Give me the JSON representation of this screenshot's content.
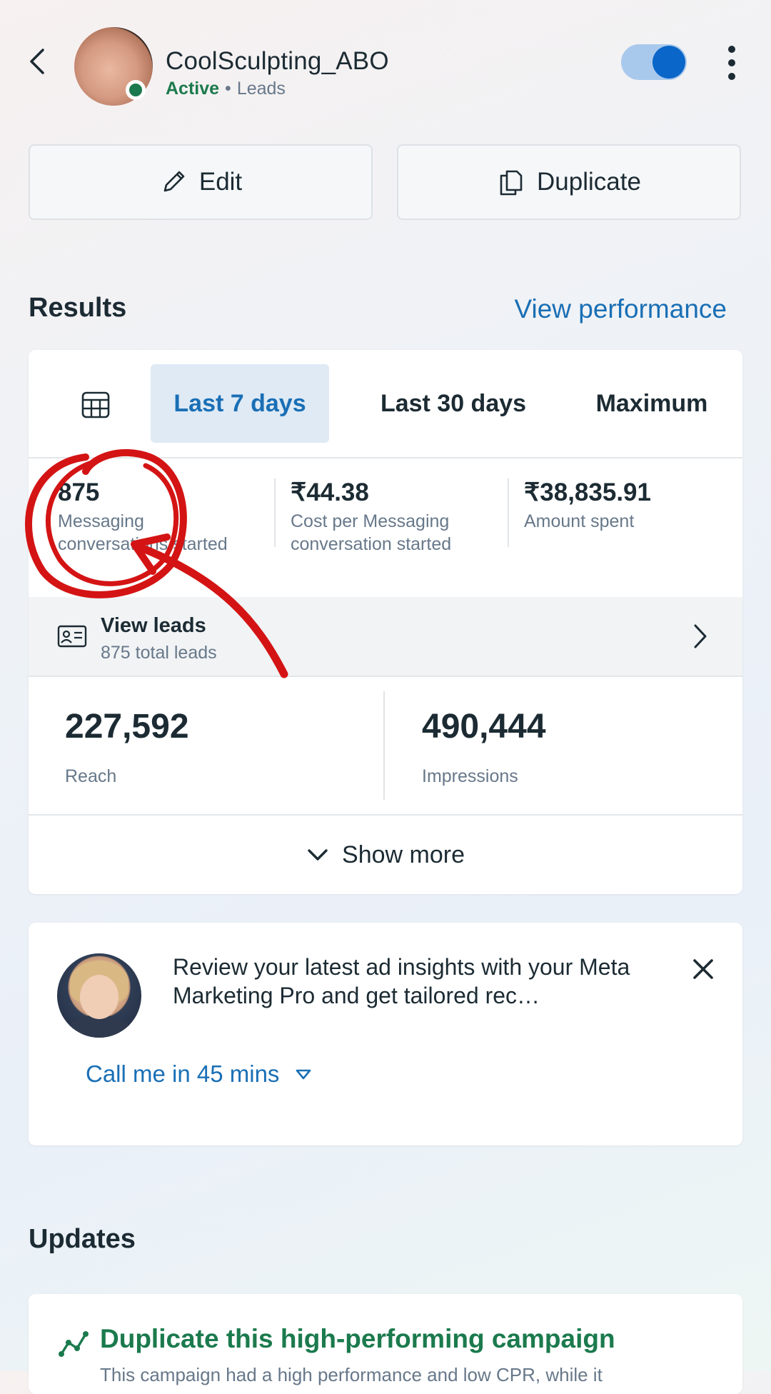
{
  "header": {
    "campaign_name": "CoolSculpting_ABO",
    "status": "Active",
    "separator": "•",
    "objective": "Leads",
    "toggle_on": true
  },
  "actions": {
    "edit_label": "Edit",
    "duplicate_label": "Duplicate"
  },
  "results": {
    "heading": "Results",
    "view_performance": "View performance",
    "tabs": [
      {
        "label": "Last 7 days",
        "selected": true
      },
      {
        "label": "Last 30 days",
        "selected": false
      },
      {
        "label": "Maximum",
        "selected": false
      }
    ],
    "metrics": [
      {
        "value": "875",
        "label": "Messaging conversations started"
      },
      {
        "value": "₹44.38",
        "label": "Cost per Messaging conversation started"
      },
      {
        "value": "₹38,835.91",
        "label": "Amount spent"
      }
    ],
    "leads": {
      "title": "View leads",
      "subtitle": "875 total leads"
    },
    "reach": {
      "value": "227,592",
      "label": "Reach"
    },
    "impressions": {
      "value": "490,444",
      "label": "Impressions"
    },
    "show_more": "Show more"
  },
  "pro_card": {
    "text": "Review your latest ad insights with your Meta Marketing Pro and get tailored rec…",
    "call_label": "Call me in 45 mins"
  },
  "updates": {
    "heading": "Updates",
    "title": "Duplicate this high-performing campaign",
    "subtitle": "This campaign had a high performance and low CPR, while it"
  },
  "colors": {
    "accent_blue": "#1a6fb5",
    "active_green": "#1b7a4d",
    "annotation_red": "#d41414"
  }
}
